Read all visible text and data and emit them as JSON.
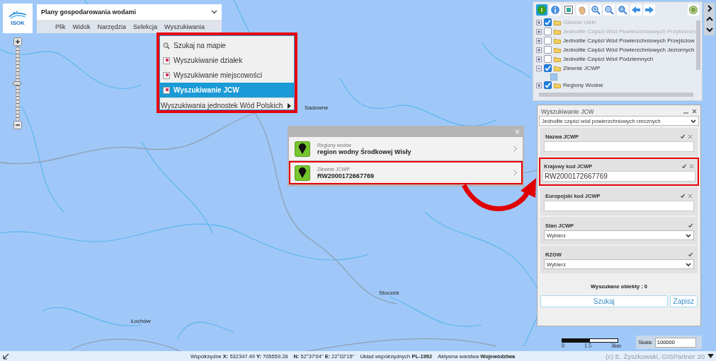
{
  "app": {
    "logo": "ISOK",
    "title": "Plany gospodarowania wodami",
    "menu": [
      "Plik",
      "Widok",
      "Narzędzia",
      "Selekcja",
      "Wyszukiwania"
    ]
  },
  "zoom_slider": {
    "level": 0.5
  },
  "search_menu": [
    {
      "kind": "search",
      "label": "Szukaj na mapie",
      "selected": false
    },
    {
      "kind": "form",
      "label": "Wyszukiwanie działek",
      "selected": false
    },
    {
      "kind": "form",
      "label": "Wyszukiwanie miejscowości",
      "selected": false
    },
    {
      "kind": "form",
      "label": "Wyszukiwanie JCW",
      "selected": true
    },
    {
      "kind": "submenu",
      "label": "Wyszukiwania jednostek Wód Polskich",
      "selected": false
    }
  ],
  "map_labels": [
    "Sadowne",
    "Stoczek",
    "Łochów"
  ],
  "popup": {
    "results": [
      {
        "layer": "Regiony wodne",
        "value": "region wodny Środkowej Wisły",
        "highlighted": false
      },
      {
        "layer": "Zlewnie JCWP",
        "value": "RW2000172667769",
        "highlighted": true
      }
    ]
  },
  "toolbar": [
    {
      "kind": "identify",
      "selected": true
    },
    {
      "kind": "info",
      "selected": false
    },
    {
      "kind": "layers",
      "selected": false
    },
    {
      "kind": "pan",
      "selected": false
    },
    {
      "kind": "zoom-in",
      "selected": false
    },
    {
      "kind": "zoom-out",
      "selected": false
    },
    {
      "kind": "zoom-extent",
      "selected": false
    },
    {
      "kind": "back",
      "selected": false
    },
    {
      "kind": "forward",
      "selected": false
    },
    {
      "kind": "help",
      "selected": false
    }
  ],
  "layer_tree": [
    {
      "label": "Główne rzeki",
      "checked": true,
      "expanded": false,
      "disabled": true
    },
    {
      "label": "Jednolite Części Wód Powierzchniowych Przybrzezn",
      "checked": false,
      "expanded": false,
      "disabled": true
    },
    {
      "label": "Jednolite Części Wód Powierzchniowych Przejściow",
      "checked": false,
      "expanded": false,
      "disabled": false
    },
    {
      "label": "Jednolite Części Wód Powierzchniowych Jeziornych",
      "checked": false,
      "expanded": false,
      "disabled": false
    },
    {
      "label": "Jednolite Części Wód Podziemnych",
      "checked": false,
      "expanded": false,
      "disabled": false
    },
    {
      "label": "Zlewnie JCWP",
      "checked": true,
      "expanded": true,
      "disabled": false
    },
    {
      "label": "Regiony Wodne",
      "checked": true,
      "expanded": false,
      "disabled": false
    }
  ],
  "search_panel": {
    "title": "Wyszukiwanie JCW",
    "type": "Jednolite części wód powierzchniowych rzecznych",
    "fields": [
      {
        "kind": "text",
        "label": "Nazwa JCWP",
        "highlighted": false
      },
      {
        "kind": "text",
        "label": "Krajowy kod JCWP",
        "value": "RW2000172667769",
        "highlighted": true
      },
      {
        "kind": "text",
        "label": "Europejski kod JCWP",
        "highlighted": false
      },
      {
        "kind": "select",
        "label": "Stan JCWP",
        "value": "Wybierz",
        "highlighted": false
      },
      {
        "kind": "select",
        "label": "RZGW",
        "value": "Wybierz",
        "highlighted": false
      }
    ],
    "result_count": "Wyszukane obiekty : 0",
    "buttons": [
      "Szukaj",
      "Zapisz"
    ]
  },
  "scale": {
    "bar_labels": [
      "0",
      "1.5",
      "3km"
    ],
    "label": "Skala:",
    "value": "100000"
  },
  "status_bar": {
    "coordinates": "Współrzędne **X:** 532347.49 **Y:** 705559.28",
    "geographic": "**N:** 52°37'04\" **E:** 22°02'15\"",
    "crs": "Układ współrzędnych **PL-1992**",
    "active_layer": "Aktywna warstwa **Województwa**",
    "copyright": "(c) E. Żyszkowski, GISPartner 20"
  }
}
